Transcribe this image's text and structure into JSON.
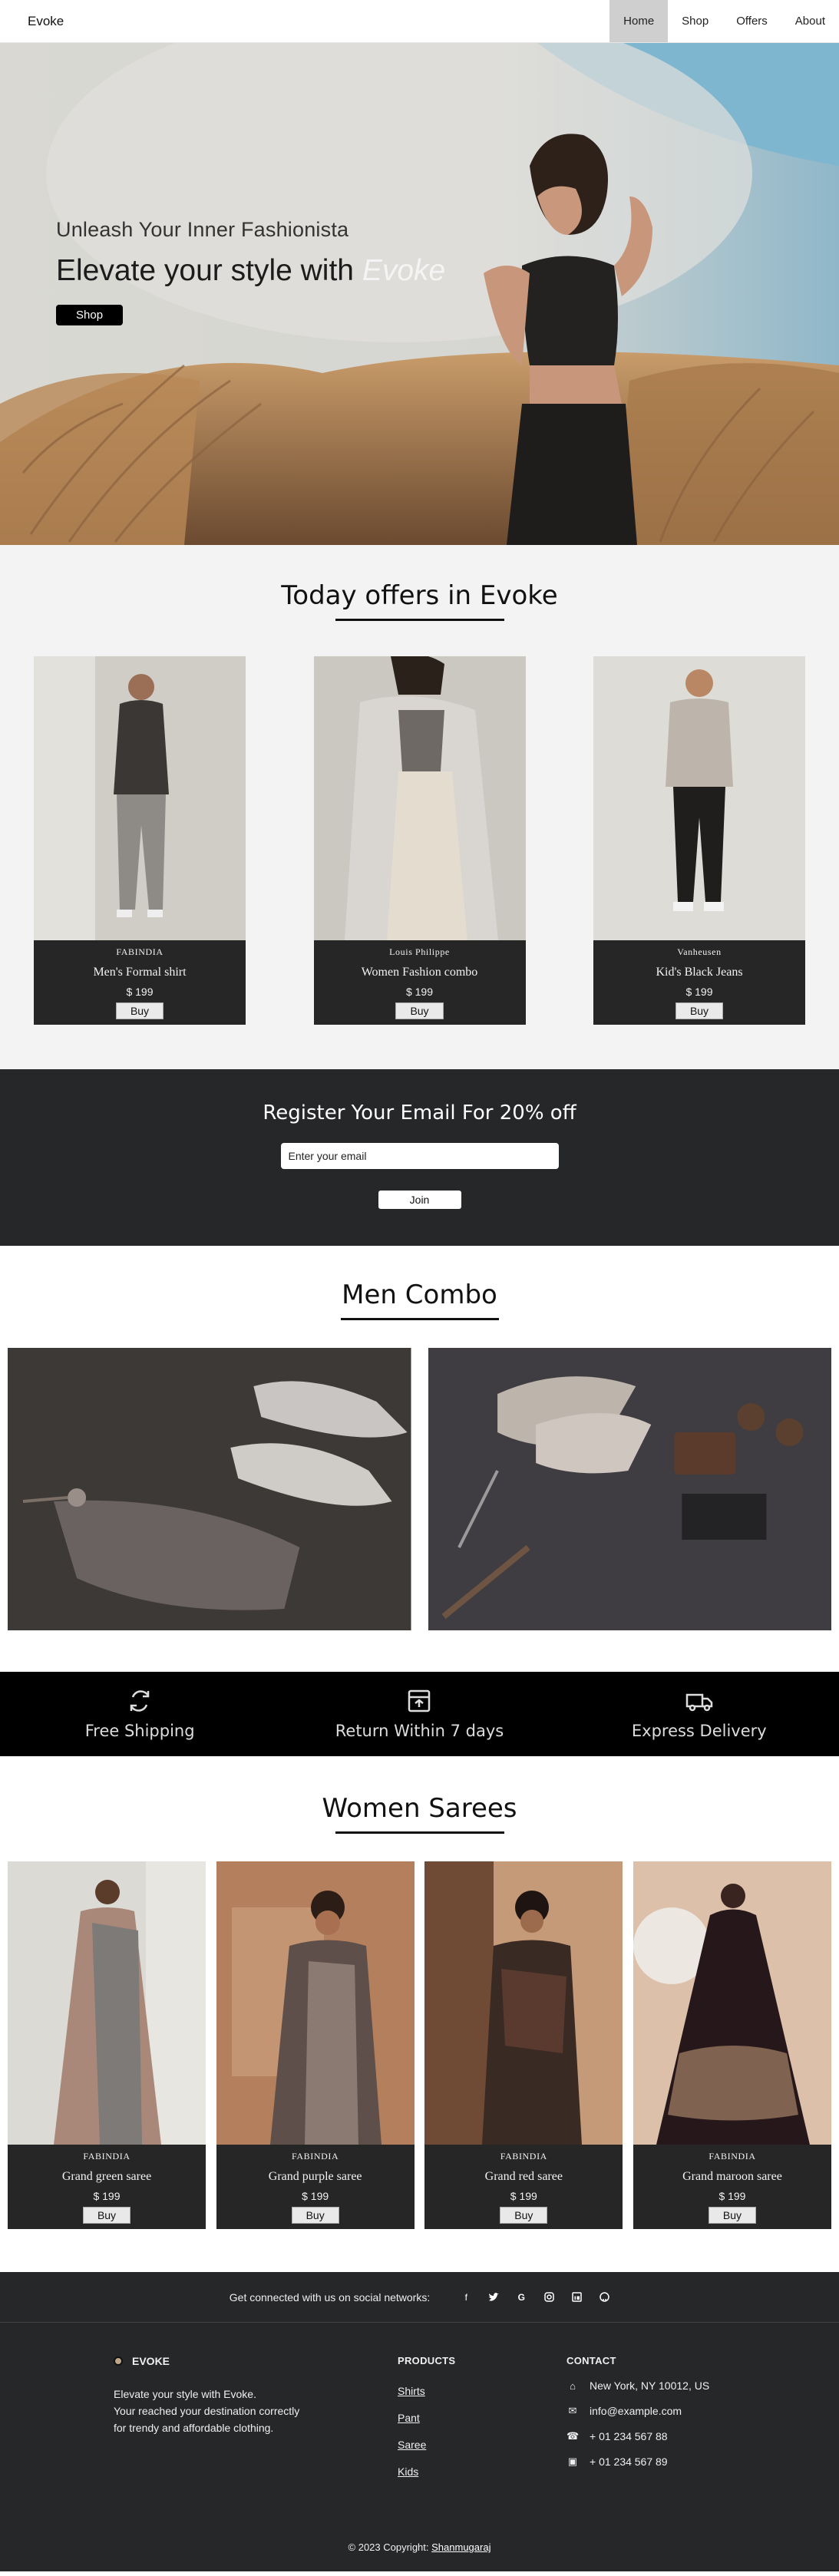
{
  "nav": {
    "brand": "Evoke",
    "links": [
      "Home",
      "Shop",
      "Offers",
      "About"
    ],
    "active": "Home"
  },
  "hero": {
    "subtitle": "Unleash Your Inner Fashionista",
    "title_prefix": "Elevate your style with",
    "title_accent": "Evoke",
    "button": "Shop"
  },
  "offers": {
    "title": "Today offers in Evoke",
    "items": [
      {
        "brand": "FABINDIA",
        "name": "Men's Formal shirt",
        "price": "$ 199",
        "button": "Buy"
      },
      {
        "brand": "Louis Philippe",
        "name": "Women Fashion combo",
        "price": "$ 199",
        "button": "Buy"
      },
      {
        "brand": "Vanheusen",
        "name": "Kid's Black Jeans",
        "price": "$ 199",
        "button": "Buy"
      }
    ]
  },
  "register": {
    "title": "Register Your Email For 20% off",
    "placeholder": "Enter your email",
    "button": "Join"
  },
  "men": {
    "title": "Men Combo"
  },
  "features": [
    {
      "label": "Free Shipping",
      "icon": "refresh-box-icon"
    },
    {
      "label": "Return Within 7 days",
      "icon": "return-box-icon"
    },
    {
      "label": "Express Delivery",
      "icon": "truck-icon"
    }
  ],
  "sarees": {
    "title": "Women Sarees",
    "items": [
      {
        "brand": "FABINDIA",
        "name": "Grand green saree",
        "price": "$ 199",
        "button": "Buy"
      },
      {
        "brand": "FABINDIA",
        "name": "Grand purple saree",
        "price": "$ 199",
        "button": "Buy"
      },
      {
        "brand": "FABINDIA",
        "name": "Grand red saree",
        "price": "$ 199",
        "button": "Buy"
      },
      {
        "brand": "FABINDIA",
        "name": "Grand maroon saree",
        "price": "$ 199",
        "button": "Buy"
      }
    ]
  },
  "social": {
    "text": "Get connected with us on social networks:",
    "icons": [
      "facebook-icon",
      "twitter-icon",
      "google-icon",
      "instagram-icon",
      "linkedin-icon",
      "github-icon"
    ]
  },
  "footer": {
    "brand": "EVOKE",
    "desc_lines": [
      "Elevate your style with Evoke.",
      "Your reached your destination correctly",
      "for trendy and affordable clothing."
    ],
    "products_title": "PRODUCTS",
    "products": [
      "Shirts",
      "Pant",
      "Saree",
      "Kids"
    ],
    "contact_title": "CONTACT",
    "contact": [
      {
        "icon": "home-icon",
        "text": "New York, NY 10012, US"
      },
      {
        "icon": "envelope-icon",
        "text": "info@example.com"
      },
      {
        "icon": "phone-icon",
        "text": "+ 01 234 567 88"
      },
      {
        "icon": "printer-icon",
        "text": "+ 01 234 567 89"
      }
    ],
    "copyright_prefix": "© 2023 Copyright:",
    "copyright_link": "Shanmugaraj"
  }
}
